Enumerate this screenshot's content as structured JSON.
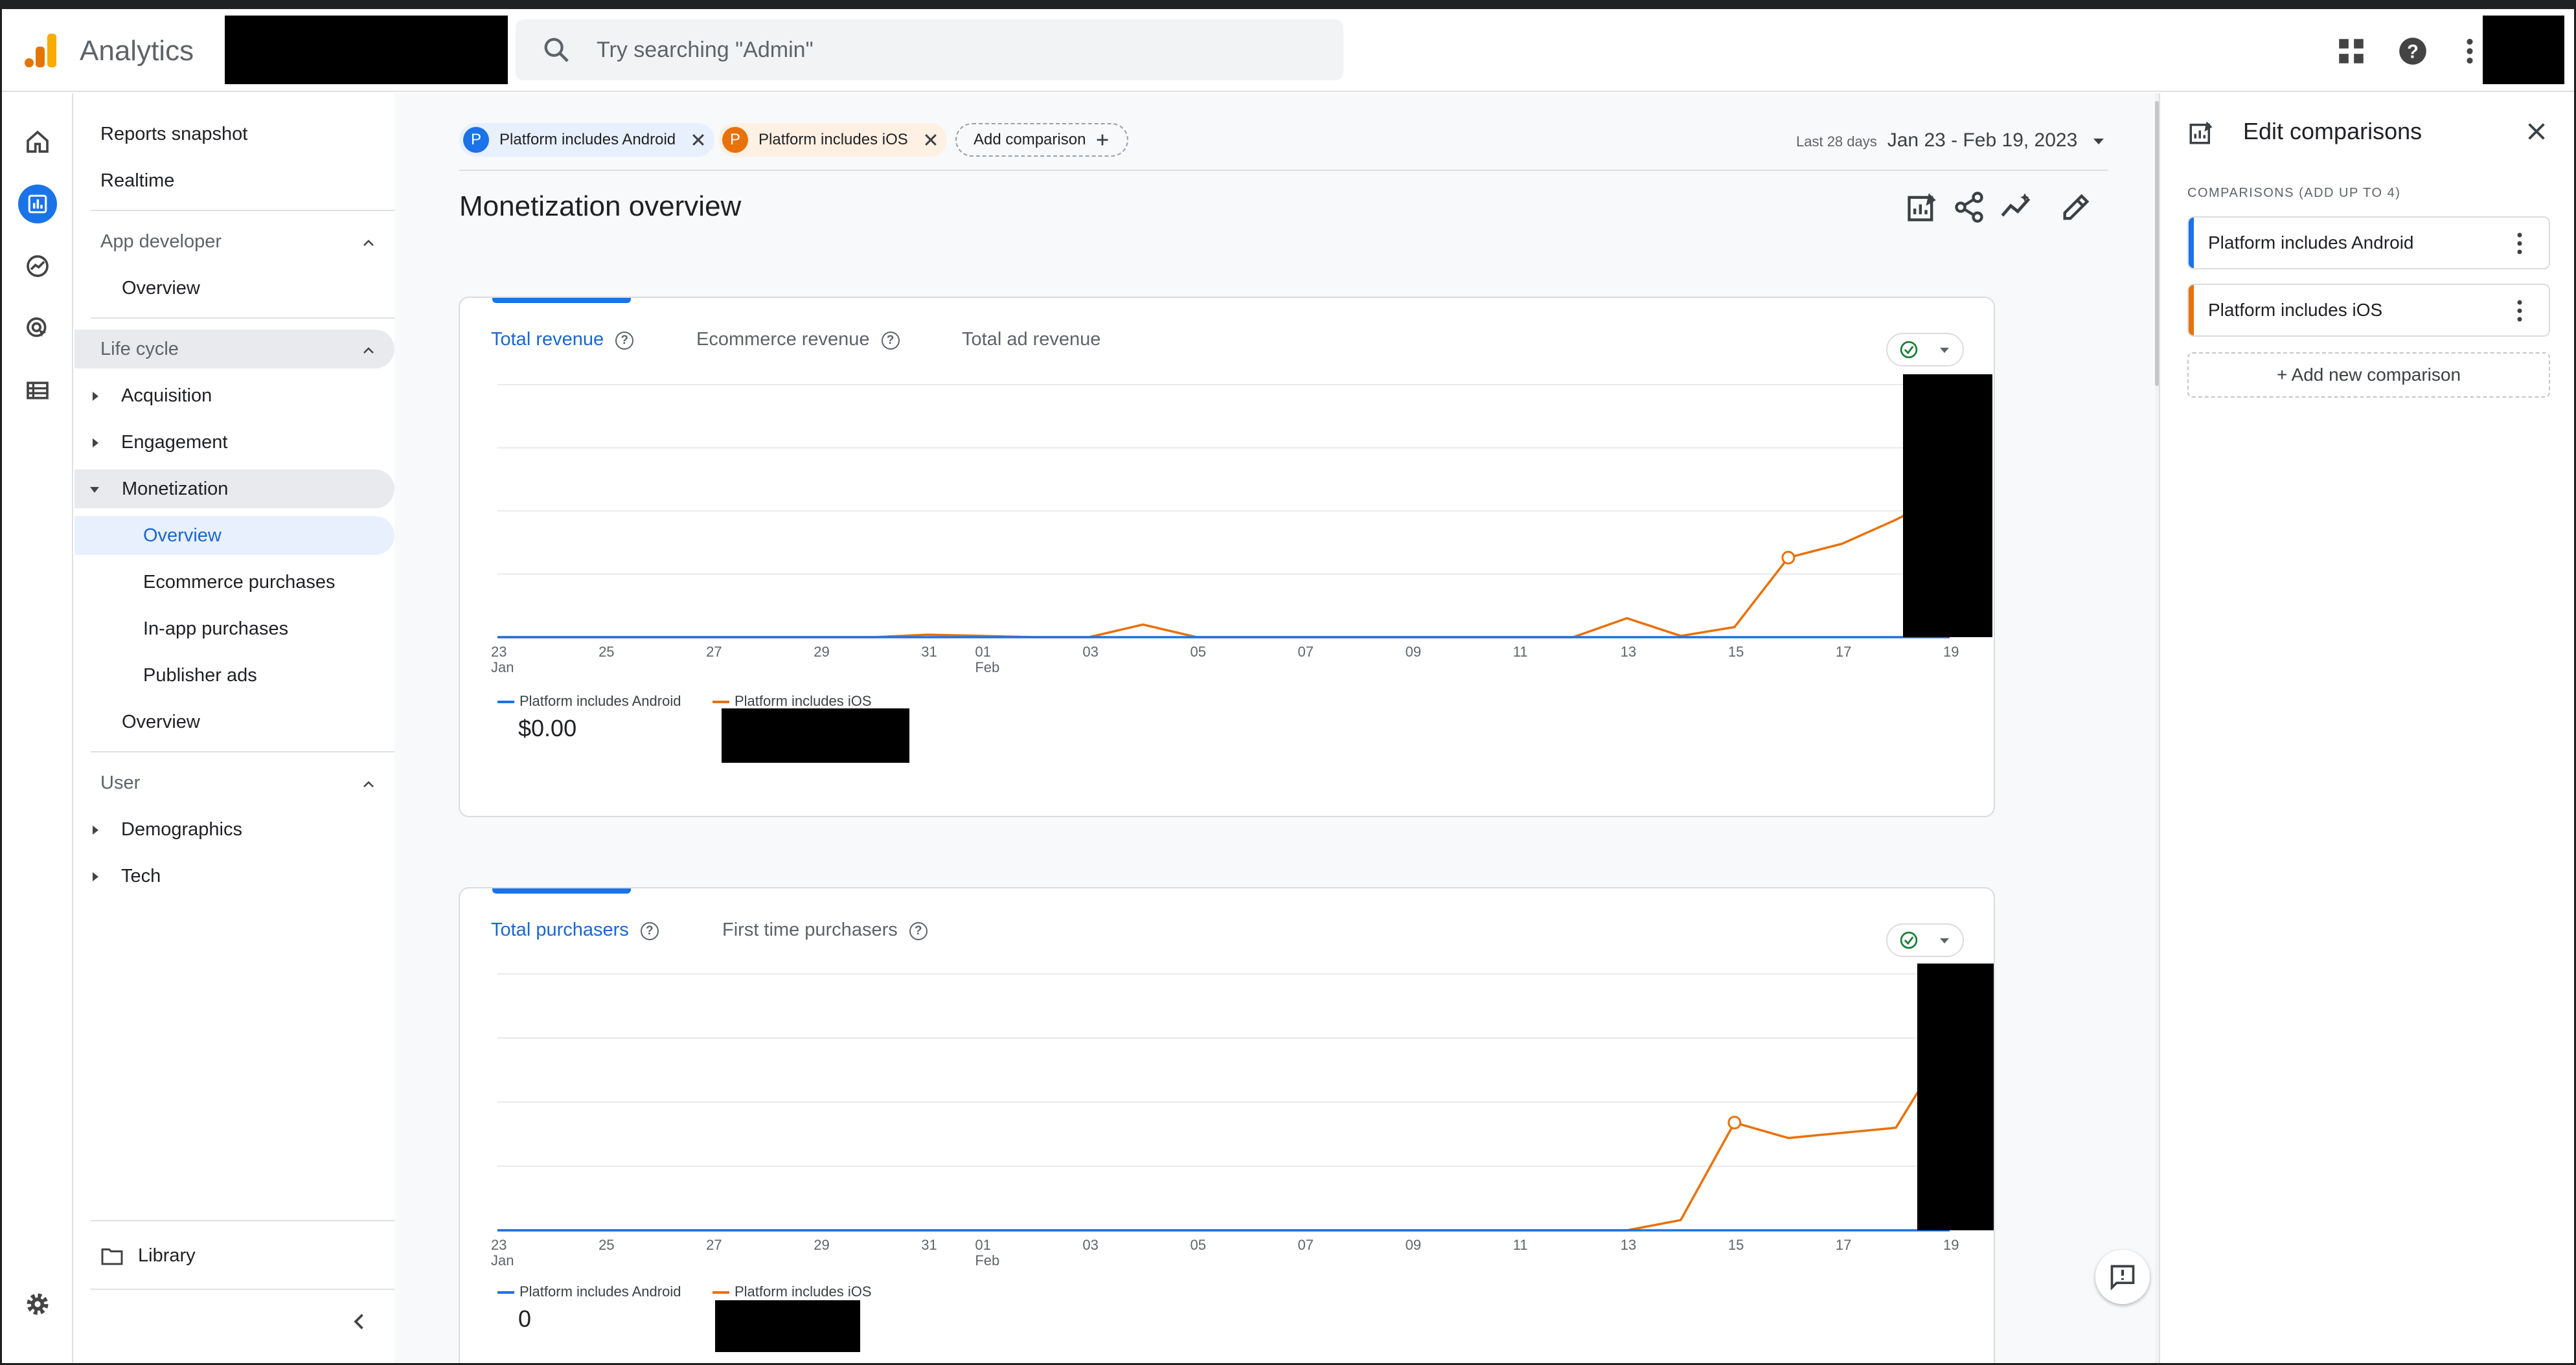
{
  "header": {
    "app_name": "Analytics",
    "search_placeholder": "Try searching \"Admin\""
  },
  "colors": {
    "android": "#1a73e8",
    "ios": "#e8710a",
    "accent": "#1a73e8"
  },
  "nav": {
    "reports_snapshot": "Reports snapshot",
    "realtime": "Realtime",
    "app_developer": "App developer",
    "app_dev_overview": "Overview",
    "life_cycle": "Life cycle",
    "acquisition": "Acquisition",
    "engagement": "Engagement",
    "monetization": "Monetization",
    "mon_overview": "Overview",
    "ecommerce_purchases": "Ecommerce purchases",
    "in_app_purchases": "In-app purchases",
    "publisher_ads": "Publisher ads",
    "lc_overview": "Overview",
    "user": "User",
    "demographics": "Demographics",
    "tech": "Tech",
    "library": "Library"
  },
  "comparisons_bar": {
    "chip_android": {
      "avatar": "P",
      "label": "Platform includes Android"
    },
    "chip_ios": {
      "avatar": "P",
      "label": "Platform includes iOS"
    },
    "add_comparison": "Add comparison",
    "date_prefix": "Last 28 days",
    "date_range": "Jan 23 - Feb 19, 2023"
  },
  "page_title": "Monetization overview",
  "card1": {
    "tabs": [
      "Total revenue",
      "Ecommerce revenue",
      "Total ad revenue"
    ],
    "legend_android": "Platform includes Android",
    "legend_ios": "Platform includes iOS",
    "android_value": "$0.00"
  },
  "card2": {
    "tabs": [
      "Total purchasers",
      "First time purchasers"
    ],
    "legend_android": "Platform includes Android",
    "legend_ios": "Platform includes iOS",
    "android_value": "0"
  },
  "chart_data": [
    {
      "type": "line",
      "x": [
        "23",
        "24",
        "25",
        "26",
        "27",
        "28",
        "29",
        "30",
        "31",
        "01",
        "02",
        "03",
        "04",
        "05",
        "06",
        "07",
        "08",
        "09",
        "10",
        "11",
        "12",
        "13",
        "14",
        "15",
        "16",
        "17",
        "18",
        "19"
      ],
      "x_tick_labels": [
        "23",
        "25",
        "27",
        "29",
        "31",
        "01",
        "03",
        "05",
        "07",
        "09",
        "11",
        "13",
        "15",
        "17",
        "19"
      ],
      "x_sub_labels": {
        "23": "Jan",
        "01": "Feb"
      },
      "series": [
        {
          "name": "Platform includes Android",
          "values": [
            0,
            0,
            0,
            0,
            0,
            0,
            0,
            0,
            0,
            0,
            0,
            0,
            0,
            0,
            0,
            0,
            0,
            0,
            0,
            0,
            0,
            0,
            0,
            0,
            0,
            0,
            0,
            0
          ]
        },
        {
          "name": "Platform includes iOS",
          "values": [
            0,
            0,
            0,
            0,
            0,
            0,
            0,
            0,
            0.2,
            0.1,
            0,
            0,
            1.0,
            0,
            0,
            0,
            0,
            0,
            0,
            0,
            0,
            1.5,
            0.1,
            0.8,
            6.3,
            7.4,
            9.3,
            11.5
          ]
        }
      ],
      "ylim": [
        0,
        20
      ],
      "grid": true
    },
    {
      "type": "line",
      "x": [
        "23",
        "24",
        "25",
        "26",
        "27",
        "28",
        "29",
        "30",
        "31",
        "01",
        "02",
        "03",
        "04",
        "05",
        "06",
        "07",
        "08",
        "09",
        "10",
        "11",
        "12",
        "13",
        "14",
        "15",
        "16",
        "17",
        "18",
        "19"
      ],
      "x_tick_labels": [
        "23",
        "25",
        "27",
        "29",
        "31",
        "01",
        "03",
        "05",
        "07",
        "09",
        "11",
        "13",
        "15",
        "17",
        "19"
      ],
      "x_sub_labels": {
        "23": "Jan",
        "01": "Feb"
      },
      "series": [
        {
          "name": "Platform includes Android",
          "values": [
            0,
            0,
            0,
            0,
            0,
            0,
            0,
            0,
            0,
            0,
            0,
            0,
            0,
            0,
            0,
            0,
            0,
            0,
            0,
            0,
            0,
            0,
            0,
            0,
            0,
            0,
            0,
            0
          ]
        },
        {
          "name": "Platform includes iOS",
          "values": [
            0,
            0,
            0,
            0,
            0,
            0,
            0,
            0,
            0,
            0,
            0,
            0,
            0,
            0,
            0,
            0,
            0,
            0,
            0,
            0,
            0,
            0,
            0.2,
            2.1,
            1.8,
            1.9,
            2.0,
            3.7
          ]
        }
      ],
      "ylim": [
        0,
        5
      ],
      "grid": true
    }
  ],
  "panel": {
    "title": "Edit comparisons",
    "label": "COMPARISONS (ADD UP TO 4)",
    "items": [
      "Platform includes Android",
      "Platform includes iOS"
    ],
    "add_new": "+  Add new comparison"
  }
}
